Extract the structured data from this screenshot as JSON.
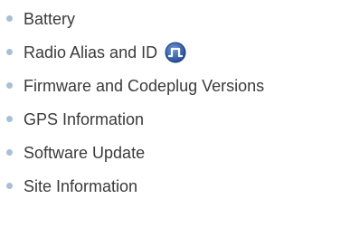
{
  "items": [
    {
      "label": "Battery"
    },
    {
      "label": "Radio Alias and ID",
      "icon": "signal-pulse-icon"
    },
    {
      "label": "Firmware and Codeplug Versions"
    },
    {
      "label": "GPS Information"
    },
    {
      "label": "Software Update"
    },
    {
      "label": "Site Information"
    }
  ],
  "colors": {
    "bullet": "#a9bfd6",
    "text": "#3a3a3a",
    "icon_fill": "#2f5fa8"
  }
}
